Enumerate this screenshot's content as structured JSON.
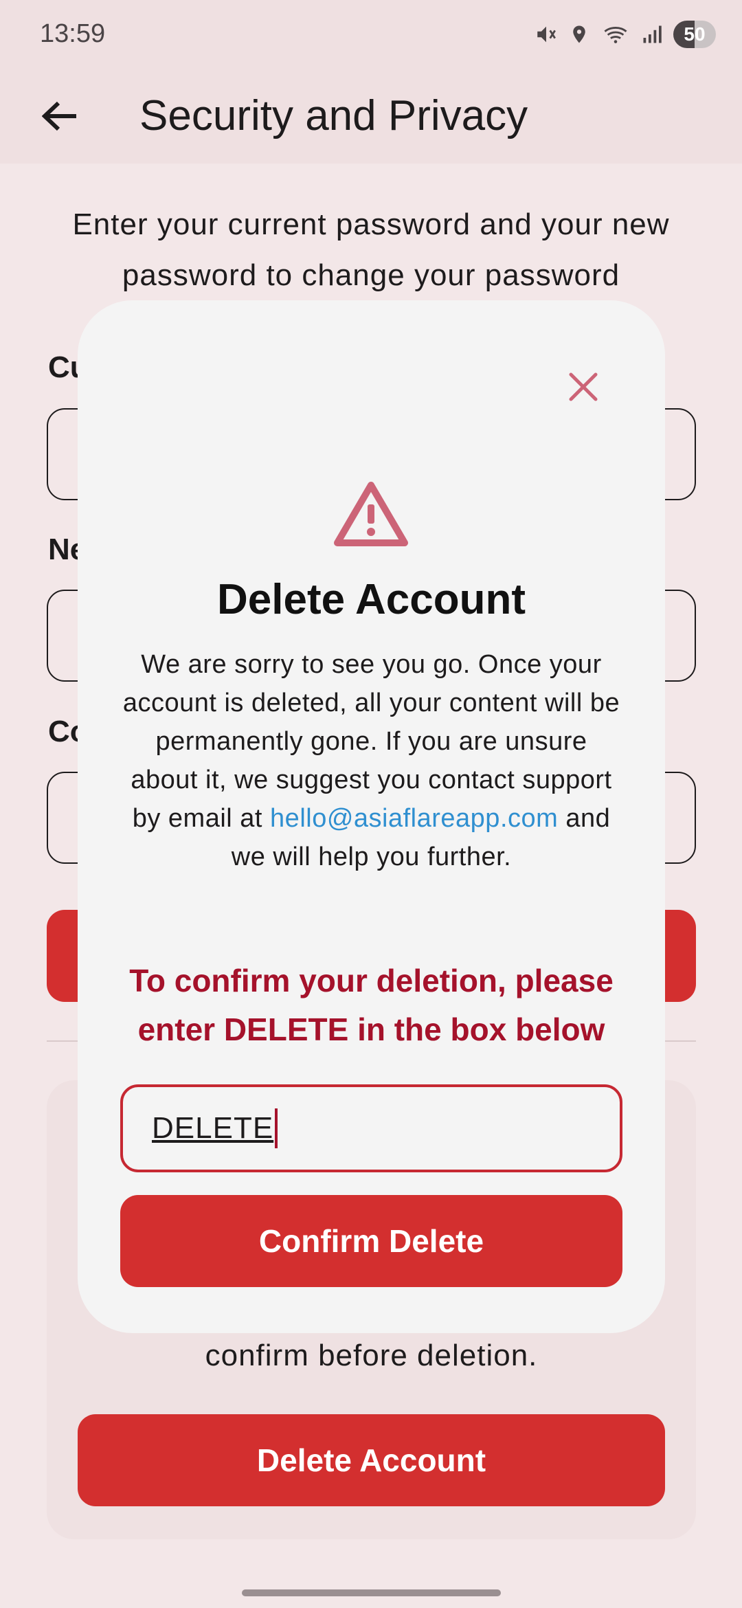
{
  "status_bar": {
    "time": "13:59",
    "battery_level": "50",
    "icons": [
      "mute-icon",
      "location-icon",
      "wifi-icon",
      "signal-icon",
      "battery-icon"
    ]
  },
  "app_bar": {
    "title": "Security and Privacy",
    "back_icon": "arrow-back-icon"
  },
  "background": {
    "intro": "Enter your current password and your new password to change your password",
    "field_labels": [
      "Cu",
      "Ne",
      "Co"
    ],
    "danger_text": "confirm before deletion.",
    "delete_account_label": "Delete Account"
  },
  "modal": {
    "title": "Delete Account",
    "body_before_link": "We are sorry to see you go. Once your account is deleted, all your content will be permanently gone. If you are unsure about it, we suggest you contact support by email at ",
    "email": "hello@asiaflareapp.com",
    "body_after_link": " and we will help you further.",
    "confirm_instruction": "To confirm your deletion, please enter DELETE in the box below",
    "input_value": "DELETE",
    "confirm_button_label": "Confirm Delete",
    "close_icon": "close-icon",
    "warning_icon": "warning-icon"
  },
  "colors": {
    "accent_red": "#d32f2f",
    "instruction_red": "#a5122b",
    "link_blue": "#2f8fd0",
    "icon_pink": "#cc6477"
  }
}
